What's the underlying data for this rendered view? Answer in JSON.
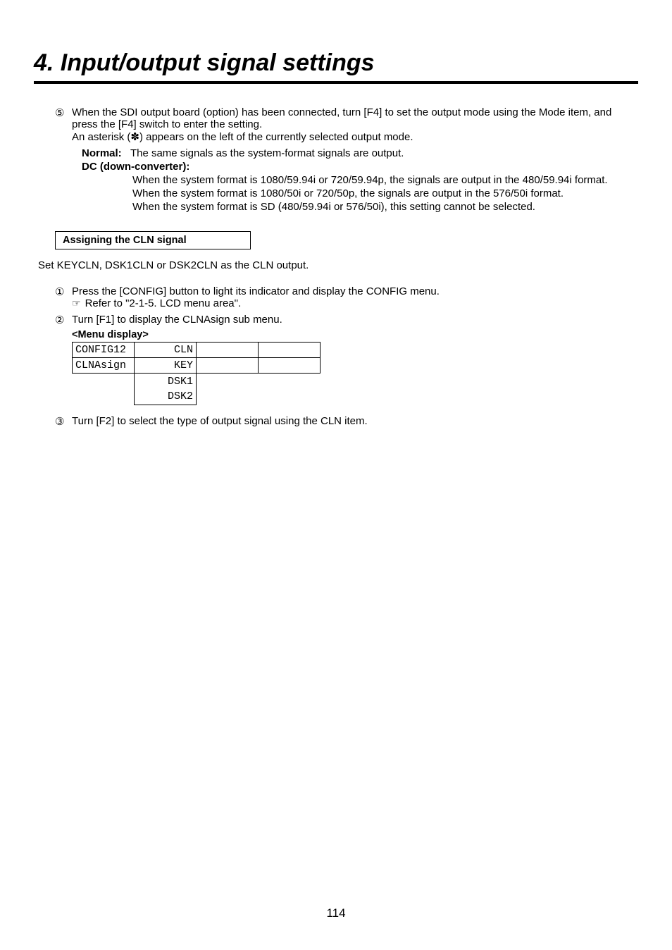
{
  "title": "4. Input/output signal settings",
  "step5": {
    "marker": "⑤",
    "line1": "When the SDI output board (option) has been connected, turn [F4] to set the output mode using the Mode item, and press the [F4] switch to enter the setting.",
    "line2_prefix": "An asterisk (",
    "line2_symbol": "✽",
    "line2_suffix": ") appears on the left of the currently selected output mode."
  },
  "normal": {
    "label": "Normal:",
    "text": "The same signals as the system-format signals are output."
  },
  "dc": {
    "label": "DC (down-converter):",
    "line1": "When the system format is 1080/59.94i or 720/59.94p, the signals are output in the 480/59.94i format.",
    "line2": "When the system format is 1080/50i or 720/50p, the signals are output in the 576/50i format.",
    "line3": "When the system format is SD (480/59.94i or 576/50i), this setting cannot be selected."
  },
  "cln": {
    "heading": "Assigning the CLN signal",
    "intro": "Set KEYCLN, DSK1CLN or DSK2CLN as the CLN output."
  },
  "step1": {
    "marker": "①",
    "text": "Press the [CONFIG] button to light its indicator and display the CONFIG menu.",
    "refer_icon": "☞",
    "refer": "Refer to \"2-1-5. LCD menu area\"."
  },
  "step2": {
    "marker": "②",
    "text": "Turn [F1] to display the CLNAsign sub menu."
  },
  "menu_label": "<Menu display>",
  "menu": {
    "r1c1": "CONFIG12",
    "r1c2": "CLN",
    "r2c1": "CLNAsign",
    "r2c2": "KEY",
    "r3": "DSK1",
    "r4": "DSK2"
  },
  "step3": {
    "marker": "③",
    "text": "Turn [F2] to select the type of output signal using the CLN item."
  },
  "page_number": "114"
}
